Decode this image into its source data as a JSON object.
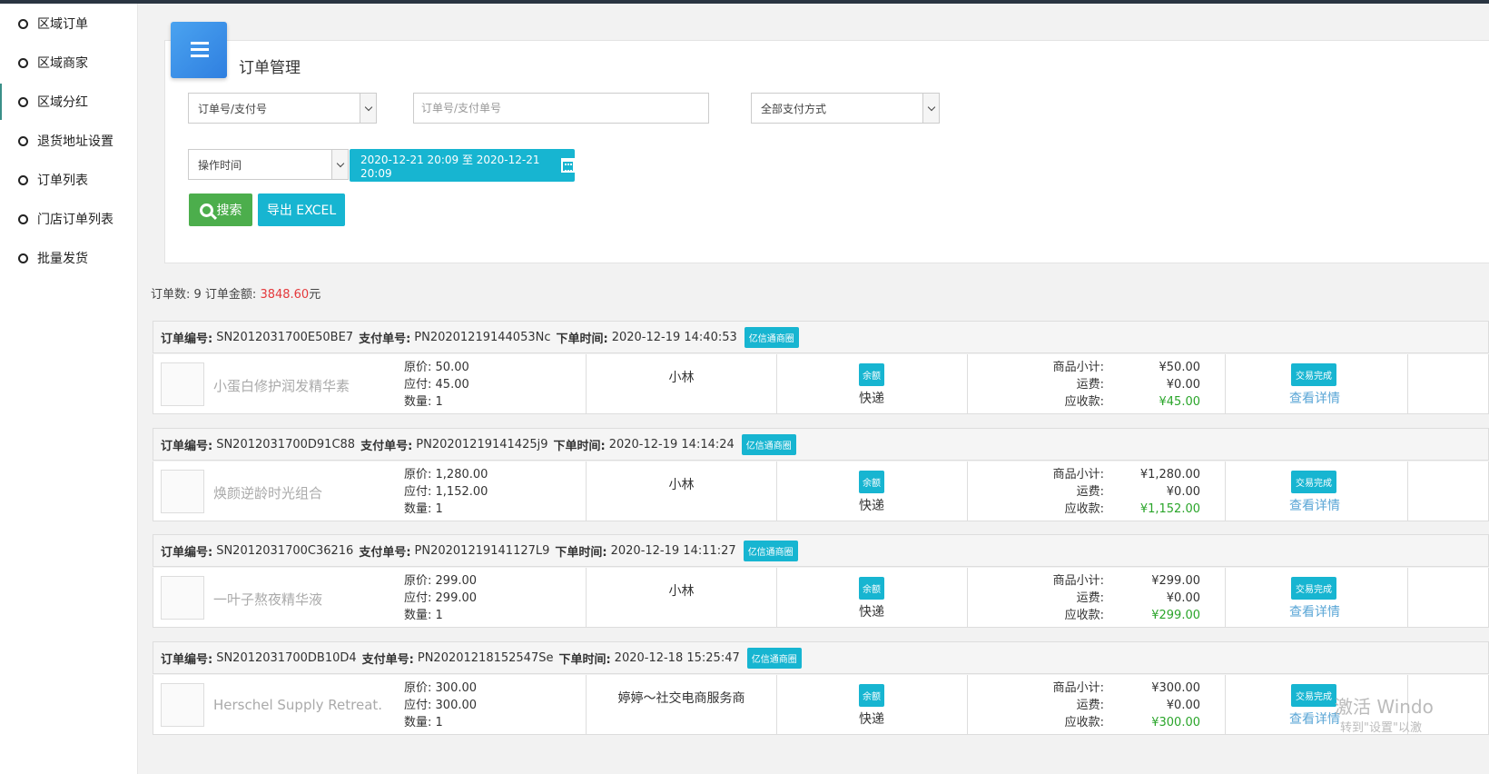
{
  "sidebar": {
    "items": [
      {
        "label": "区域订单"
      },
      {
        "label": "区域商家"
      },
      {
        "label": "区域分红"
      },
      {
        "label": "退货地址设置"
      },
      {
        "label": "订单列表"
      },
      {
        "label": "门店订单列表"
      },
      {
        "label": "批量发货"
      }
    ]
  },
  "panel": {
    "title": "订单管理",
    "search_type": "订单号/支付号",
    "search_placeholder": "订单号/支付单号",
    "pay_method": "全部支付方式",
    "time_type": "操作时间",
    "date_range": "2020-12-21 20:09 至 2020-12-21 20:09",
    "search_label": "搜索",
    "export_label": "导出 EXCEL"
  },
  "summary": {
    "count_text": "订单数: 9 订单金额: ",
    "amount": "3848.60",
    "unit": "元"
  },
  "labels": {
    "order_no": "订单编号:",
    "pay_no": "支付单号:",
    "order_time": "下单时间:",
    "original_price": "原价:",
    "payable": "应付:",
    "quantity": "数量:",
    "subtotal": "商品小计:",
    "freight": "运费:",
    "receivable": "应收款:",
    "detail_link": "查看详情"
  },
  "orders": [
    {
      "order_no": "SN2012031700E50BE7",
      "pay_no": "PN20201219144053Nc",
      "time": "2020-12-19 14:40:53",
      "tag": "亿信通商圈",
      "product": "小蛋白修护润发精华素",
      "original": "50.00",
      "payable": "45.00",
      "qty": "1",
      "buyer": "小林",
      "pay_tag": "余额",
      "ship": "快递",
      "subtotal": "¥50.00",
      "freight": "¥0.00",
      "receivable": "¥45.00",
      "status": "交易完成"
    },
    {
      "order_no": "SN2012031700D91C88",
      "pay_no": "PN20201219141425j9",
      "time": "2020-12-19 14:14:24",
      "tag": "亿信通商圈",
      "product": "焕颜逆龄时光组合",
      "original": "1,280.00",
      "payable": "1,152.00",
      "qty": "1",
      "buyer": "小林",
      "pay_tag": "余额",
      "ship": "快递",
      "subtotal": "¥1,280.00",
      "freight": "¥0.00",
      "receivable": "¥1,152.00",
      "status": "交易完成"
    },
    {
      "order_no": "SN2012031700C36216",
      "pay_no": "PN20201219141127L9",
      "time": "2020-12-19 14:11:27",
      "tag": "亿信通商圈",
      "product": "一叶子熬夜精华液",
      "original": "299.00",
      "payable": "299.00",
      "qty": "1",
      "buyer": "小林",
      "pay_tag": "余额",
      "ship": "快递",
      "subtotal": "¥299.00",
      "freight": "¥0.00",
      "receivable": "¥299.00",
      "status": "交易完成"
    },
    {
      "order_no": "SN2012031700DB10D4",
      "pay_no": "PN20201218152547Se",
      "time": "2020-12-18 15:25:47",
      "tag": "亿信通商圈",
      "product": "Herschel Supply Retreat...",
      "original": "300.00",
      "payable": "300.00",
      "qty": "1",
      "buyer": "婷婷～社交电商服务商",
      "pay_tag": "余额",
      "ship": "快递",
      "subtotal": "¥300.00",
      "freight": "¥0.00",
      "receivable": "¥300.00",
      "status": "交易完成"
    }
  ],
  "watermark": {
    "line1": "激活 Windo",
    "line2": "转到\"设置\"以激"
  },
  "colors": {
    "accent": "#17b5d1",
    "green_button": "#4cae4c",
    "amount_red": "#e4393c",
    "receivable_green": "#2aa52a"
  }
}
